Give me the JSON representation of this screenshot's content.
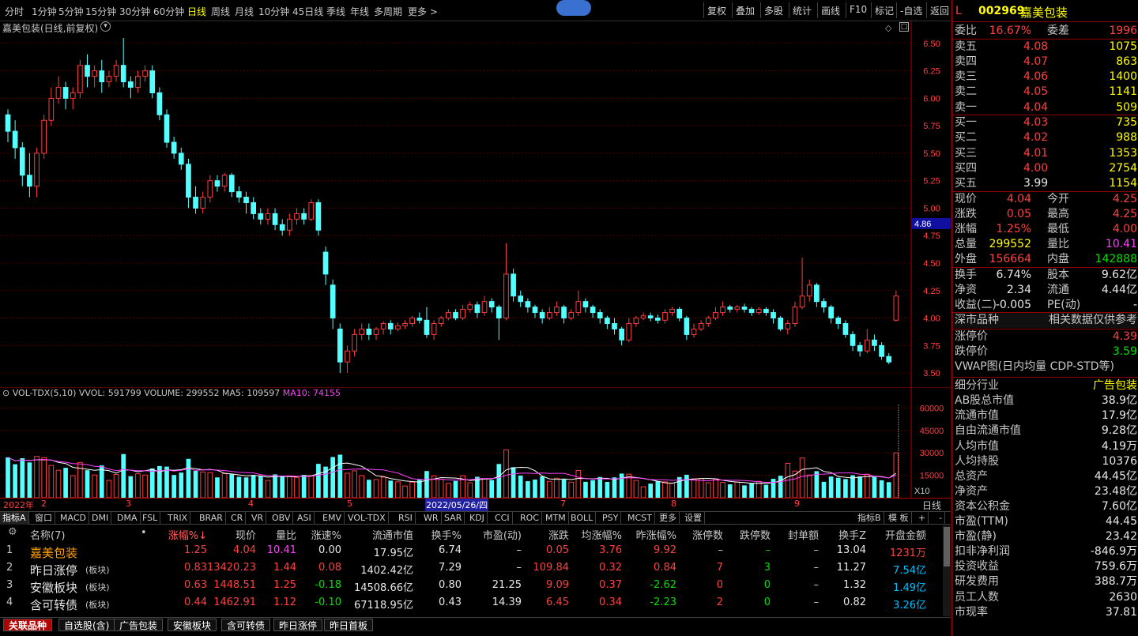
{
  "toolbar": {
    "periods": [
      "分时",
      "1分钟",
      "5分钟",
      "15分钟",
      "30分钟",
      "60分钟",
      "日线",
      "周线",
      "月线",
      "10分钟",
      "45日线",
      "季线",
      "年线",
      "多周期",
      "更多 >"
    ],
    "active_period": "日线",
    "buttons": [
      "复权",
      "叠加",
      "多股",
      "统计",
      "画线",
      "F10",
      "标记",
      "-自选",
      "返回"
    ]
  },
  "chart": {
    "title": "嘉美包装(日线,前复权)",
    "price_ticks": [
      "6.50",
      "6.25",
      "6.00",
      "5.75",
      "5.50",
      "5.25",
      "5.00",
      "4.75",
      "4.50",
      "4.25",
      "4.00",
      "3.75",
      "3.50"
    ],
    "current_price_tag": "4.86",
    "vol_header_name": "VOL-TDX(5,10)",
    "vol_header_vvol": "VVOL: 591799",
    "vol_header_volume": "VOLUME: 299552",
    "vol_header_ma5": "MA5: 109597",
    "vol_header_ma10": "MA10: 74155",
    "vol_ticks": [
      "60000",
      "45000",
      "30000",
      "15000"
    ],
    "vol_unit": "X10",
    "date_labels": [
      "2022年",
      "2",
      "3",
      "4",
      "5",
      "2022/05/26/四",
      "7",
      "8",
      "9"
    ],
    "date_right": "日线"
  },
  "chart_data": {
    "type": "candlestick",
    "title": "嘉美包装(日线,前复权)",
    "ylim": [
      3.45,
      6.6
    ],
    "candles": [
      [
        5.85,
        5.7,
        5.9,
        5.6
      ],
      [
        5.7,
        5.55,
        5.8,
        5.45
      ],
      [
        5.55,
        5.3,
        5.6,
        5.2
      ],
      [
        5.3,
        5.2,
        5.5,
        5.1
      ],
      [
        5.2,
        5.5,
        5.55,
        5.1
      ],
      [
        5.5,
        5.8,
        5.85,
        5.45
      ],
      [
        5.8,
        6.0,
        6.1,
        5.75
      ],
      [
        6.0,
        6.1,
        6.2,
        5.95
      ],
      [
        6.1,
        6.0,
        6.15,
        5.9
      ],
      [
        6.0,
        6.05,
        6.1,
        5.9
      ],
      [
        6.05,
        6.3,
        6.35,
        6.0
      ],
      [
        6.3,
        6.2,
        6.4,
        6.1
      ],
      [
        6.2,
        6.25,
        6.3,
        6.1
      ],
      [
        6.25,
        6.15,
        6.35,
        6.05
      ],
      [
        6.15,
        6.2,
        6.25,
        6.1
      ],
      [
        6.2,
        6.3,
        6.35,
        6.15
      ],
      [
        6.3,
        6.15,
        6.55,
        6.1
      ],
      [
        6.15,
        6.1,
        6.2,
        6.0
      ],
      [
        6.1,
        6.2,
        6.25,
        6.05
      ],
      [
        6.2,
        6.25,
        6.3,
        6.15
      ],
      [
        6.25,
        6.05,
        6.3,
        6.0
      ],
      [
        6.05,
        5.85,
        6.1,
        5.8
      ],
      [
        5.85,
        5.6,
        5.9,
        5.55
      ],
      [
        5.6,
        5.5,
        5.65,
        5.45
      ],
      [
        5.5,
        5.4,
        5.55,
        5.35
      ],
      [
        5.4,
        5.1,
        5.45,
        5.0
      ],
      [
        5.1,
        5.0,
        5.2,
        4.95
      ],
      [
        5.0,
        5.1,
        5.15,
        4.95
      ],
      [
        5.1,
        5.25,
        5.3,
        5.05
      ],
      [
        5.25,
        5.2,
        5.3,
        5.15
      ],
      [
        5.2,
        5.3,
        5.32,
        5.15
      ],
      [
        5.3,
        5.15,
        5.32,
        5.1
      ],
      [
        5.15,
        5.1,
        5.2,
        5.05
      ],
      [
        5.1,
        5.05,
        5.15,
        4.95
      ],
      [
        5.05,
        4.95,
        5.1,
        4.9
      ],
      [
        4.95,
        4.9,
        5.0,
        4.85
      ],
      [
        4.9,
        4.95,
        5.0,
        4.85
      ],
      [
        4.95,
        4.85,
        5.0,
        4.8
      ],
      [
        4.85,
        4.8,
        4.9,
        4.75
      ],
      [
        4.8,
        4.9,
        4.95,
        4.75
      ],
      [
        4.9,
        4.95,
        5.0,
        4.85
      ],
      [
        4.95,
        4.9,
        5.0,
        4.85
      ],
      [
        4.9,
        5.05,
        5.08,
        4.88
      ],
      [
        5.05,
        4.8,
        5.08,
        4.75
      ],
      [
        4.6,
        4.4,
        4.65,
        4.3
      ],
      [
        4.3,
        4.0,
        4.35,
        3.9
      ],
      [
        3.9,
        3.6,
        3.95,
        3.5
      ],
      [
        3.6,
        3.7,
        3.75,
        3.5
      ],
      [
        3.7,
        3.85,
        3.9,
        3.65
      ],
      [
        3.85,
        3.9,
        3.95,
        3.8
      ],
      [
        3.9,
        3.85,
        3.95,
        3.8
      ],
      [
        3.85,
        3.9,
        3.92,
        3.8
      ],
      [
        3.9,
        3.95,
        3.97,
        3.85
      ],
      [
        3.95,
        3.9,
        3.98,
        3.85
      ],
      [
        3.9,
        3.93,
        3.96,
        3.88
      ],
      [
        3.93,
        3.95,
        3.98,
        3.9
      ],
      [
        3.95,
        4.0,
        4.02,
        3.92
      ],
      [
        4.0,
        3.98,
        4.05,
        3.95
      ],
      [
        3.98,
        3.85,
        4.1,
        3.82
      ],
      [
        3.85,
        3.95,
        3.98,
        3.8
      ],
      [
        3.95,
        4.0,
        4.02,
        3.92
      ],
      [
        4.0,
        4.05,
        4.08,
        3.98
      ],
      [
        4.05,
        4.0,
        4.08,
        3.98
      ],
      [
        4.0,
        4.08,
        4.12,
        3.98
      ],
      [
        4.08,
        4.12,
        4.15,
        4.05
      ],
      [
        4.12,
        4.05,
        4.15,
        4.0
      ],
      [
        4.05,
        4.15,
        4.2,
        4.02
      ],
      [
        4.15,
        4.1,
        4.18,
        4.05
      ],
      [
        4.1,
        4.0,
        4.12,
        3.8
      ],
      [
        4.0,
        4.4,
        4.68,
        3.98
      ],
      [
        4.4,
        4.2,
        4.45,
        4.15
      ],
      [
        4.2,
        4.15,
        4.25,
        4.1
      ],
      [
        4.15,
        4.1,
        4.18,
        4.05
      ],
      [
        4.1,
        4.05,
        4.12,
        4.0
      ],
      [
        4.05,
        4.0,
        4.08,
        3.95
      ],
      [
        4.0,
        4.05,
        4.1,
        3.98
      ],
      [
        4.05,
        4.1,
        4.15,
        4.02
      ],
      [
        4.1,
        4.0,
        4.12,
        3.95
      ],
      [
        4.0,
        4.05,
        4.08,
        3.98
      ],
      [
        4.05,
        4.15,
        4.25,
        4.02
      ],
      [
        4.15,
        4.1,
        4.18,
        4.05
      ],
      [
        4.1,
        4.05,
        4.12,
        4.0
      ],
      [
        4.05,
        4.0,
        4.08,
        3.95
      ],
      [
        4.0,
        3.95,
        4.02,
        3.9
      ],
      [
        3.95,
        3.9,
        4.0,
        3.85
      ],
      [
        3.9,
        3.8,
        3.92,
        3.75
      ],
      [
        3.8,
        3.95,
        4.0,
        3.78
      ],
      [
        3.95,
        4.0,
        4.02,
        3.92
      ],
      [
        4.0,
        4.02,
        4.05,
        3.98
      ],
      [
        4.02,
        4.0,
        4.05,
        3.97
      ],
      [
        4.0,
        3.98,
        4.03,
        3.95
      ],
      [
        3.98,
        4.05,
        4.08,
        3.95
      ],
      [
        4.05,
        4.08,
        4.1,
        4.02
      ],
      [
        4.08,
        4.0,
        4.1,
        3.97
      ],
      [
        4.0,
        3.85,
        4.02,
        3.8
      ],
      [
        3.85,
        3.9,
        3.95,
        3.82
      ],
      [
        3.9,
        3.95,
        3.98,
        3.88
      ],
      [
        3.95,
        4.0,
        4.02,
        3.92
      ],
      [
        4.0,
        4.05,
        4.1,
        3.98
      ],
      [
        4.05,
        4.1,
        4.15,
        4.02
      ],
      [
        4.1,
        4.08,
        4.12,
        4.05
      ],
      [
        4.08,
        4.1,
        4.12,
        4.05
      ],
      [
        4.1,
        4.08,
        4.13,
        4.05
      ],
      [
        4.08,
        4.05,
        4.1,
        4.02
      ],
      [
        4.05,
        4.08,
        4.1,
        4.03
      ],
      [
        4.08,
        4.05,
        4.1,
        4.02
      ],
      [
        4.05,
        4.0,
        4.08,
        3.95
      ],
      [
        4.0,
        3.9,
        4.02,
        3.88
      ],
      [
        3.9,
        3.95,
        3.98,
        3.85
      ],
      [
        3.95,
        4.1,
        4.15,
        3.92
      ],
      [
        4.1,
        4.2,
        4.55,
        4.08
      ],
      [
        4.2,
        4.3,
        4.35,
        4.15
      ],
      [
        4.3,
        4.15,
        4.32,
        4.1
      ],
      [
        4.15,
        4.1,
        4.18,
        4.05
      ],
      [
        4.1,
        4.0,
        4.12,
        3.95
      ],
      [
        4.0,
        3.95,
        4.02,
        3.9
      ],
      [
        3.95,
        3.85,
        3.98,
        3.82
      ],
      [
        3.85,
        3.75,
        3.88,
        3.7
      ],
      [
        3.75,
        3.7,
        3.78,
        3.65
      ],
      [
        3.7,
        3.8,
        3.9,
        3.68
      ],
      [
        3.8,
        3.75,
        3.85,
        3.7
      ],
      [
        3.75,
        3.65,
        3.78,
        3.62
      ],
      [
        3.65,
        3.6,
        3.68,
        3.58
      ],
      [
        3.98,
        4.2,
        4.25,
        3.97
      ]
    ],
    "volume_ma5_label": "MA5",
    "volume_ma10_label": "MA10"
  },
  "quote": {
    "code": "002969",
    "name": "嘉美包装",
    "flag": "L",
    "weibi_label": "委比",
    "weibi": "16.67%",
    "weicha_label": "委差",
    "weicha": "1996",
    "asks": [
      {
        "label": "卖五",
        "price": "4.08",
        "vol": "1075"
      },
      {
        "label": "卖四",
        "price": "4.07",
        "vol": "863"
      },
      {
        "label": "卖三",
        "price": "4.06",
        "vol": "1400"
      },
      {
        "label": "卖二",
        "price": "4.05",
        "vol": "1141"
      },
      {
        "label": "卖一",
        "price": "4.04",
        "vol": "509"
      }
    ],
    "bids": [
      {
        "label": "买一",
        "price": "4.03",
        "vol": "735"
      },
      {
        "label": "买二",
        "price": "4.02",
        "vol": "988"
      },
      {
        "label": "买三",
        "price": "4.01",
        "vol": "1353"
      },
      {
        "label": "买四",
        "price": "4.00",
        "vol": "2754"
      },
      {
        "label": "买五",
        "price": "3.99",
        "vol": "1154"
      }
    ],
    "stats": [
      {
        "l1": "现价",
        "v1": "4.04",
        "c1": "red",
        "l2": "今开",
        "v2": "4.25",
        "c2": "red"
      },
      {
        "l1": "涨跌",
        "v1": "0.05",
        "c1": "red",
        "l2": "最高",
        "v2": "4.25",
        "c2": "red"
      },
      {
        "l1": "涨幅",
        "v1": "1.25%",
        "c1": "red",
        "l2": "最低",
        "v2": "4.00",
        "c2": "red"
      },
      {
        "l1": "总量",
        "v1": "299552",
        "c1": "yel",
        "l2": "量比",
        "v2": "10.41",
        "c2": "mag"
      },
      {
        "l1": "外盘",
        "v1": "156664",
        "c1": "red",
        "l2": "内盘",
        "v2": "142888",
        "c2": "green"
      }
    ],
    "stats2": [
      {
        "l1": "换手",
        "v1": "6.74%",
        "c1": "wht",
        "l2": "股本",
        "v2": "9.62亿",
        "c2": "wht"
      },
      {
        "l1": "净资",
        "v1": "2.34",
        "c1": "wht",
        "l2": "流通",
        "v2": "4.44亿",
        "c2": "wht"
      },
      {
        "l1": "收益(二)",
        "v1": "-0.005",
        "c1": "wht",
        "l2": "PE(动)",
        "v2": "-",
        "c2": "wht"
      }
    ],
    "market_label": "深市品种",
    "market_note": "相关数据仅供参考",
    "limit_up_label": "涨停价",
    "limit_up": "4.39",
    "limit_down_label": "跌停价",
    "limit_down": "3.59",
    "vwap_label": "VWAP图(日内均量 CDP-STD等)",
    "fund": [
      {
        "l": "细分行业",
        "v": "广告包装"
      },
      {
        "l": "AB股总市值",
        "v": "38.9亿"
      },
      {
        "l": "流通市值",
        "v": "17.9亿"
      },
      {
        "l": "自由流通市值",
        "v": "9.28亿"
      },
      {
        "l": "人均市值",
        "v": "4.19万"
      },
      {
        "l": "人均持股",
        "v": "10376"
      },
      {
        "l": "总资产",
        "v": "44.45亿"
      },
      {
        "l": "净资产",
        "v": "23.48亿"
      },
      {
        "l": "资本公积金",
        "v": "7.60亿"
      },
      {
        "l": "市盈(TTM)",
        "v": "44.45"
      },
      {
        "l": "市盈(静)",
        "v": "23.42"
      },
      {
        "l": "扣非净利润",
        "v": "-846.9万"
      },
      {
        "l": "投资收益",
        "v": "759.6万"
      },
      {
        "l": "研发费用",
        "v": "388.7万"
      },
      {
        "l": "员工人数",
        "v": "2630"
      },
      {
        "l": "市现率",
        "v": "37.81"
      }
    ]
  },
  "indicator_tabs": [
    "指标A",
    "窗口",
    "MACD",
    "DMI",
    "DMA",
    "FSL",
    "TRIX",
    "BRAR",
    "CR",
    "VR",
    "OBV",
    "ASI",
    "EMV",
    "VOL-TDX",
    "RSI",
    "WR",
    "SAR",
    "KDJ",
    "CCI",
    "ROC",
    "MTM",
    "BOLL",
    "PSY",
    "MCST",
    "更多",
    "设置"
  ],
  "indicator_right": [
    "指标B",
    "模 板",
    "+",
    "-"
  ],
  "table": {
    "headers": [
      "",
      "名称(7)",
      "•",
      "涨幅%↓",
      "现价",
      "量比",
      "涨速%",
      "流通市值",
      "换手%",
      "市盈(动)",
      "涨跌",
      "均涨幅%",
      "昨涨幅%",
      "涨停数",
      "跌停数",
      "封单额",
      "换手Z",
      "开盘金额"
    ],
    "rows": [
      {
        "idx": "1",
        "name": "嘉美包装",
        "tag": "",
        "chg": "1.25",
        "price": "4.04",
        "lb": "10.41",
        "speed": "0.00",
        "mcap": "17.95亿",
        "hs": "6.74",
        "pe": "–",
        "zd": "0.05",
        "avg": "3.76",
        "yday": "9.92",
        "up": "–",
        "down": "–",
        "fd": "–",
        "hsz": "13.04",
        "open": "1231万"
      },
      {
        "idx": "2",
        "name": "昨日涨停",
        "tag": "(板块)",
        "chg": "0.83",
        "price": "13420.23",
        "lb": "1.44",
        "speed": "0.08",
        "mcap": "1402.42亿",
        "hs": "7.29",
        "pe": "–",
        "zd": "109.84",
        "avg": "0.32",
        "yday": "0.84",
        "up": "7",
        "down": "3",
        "fd": "–",
        "hsz": "11.27",
        "open": "7.54亿"
      },
      {
        "idx": "3",
        "name": "安徽板块",
        "tag": "(板块)",
        "chg": "0.63",
        "price": "1448.51",
        "lb": "1.25",
        "speed": "-0.18",
        "mcap": "14508.66亿",
        "hs": "0.80",
        "pe": "21.25",
        "zd": "9.09",
        "avg": "0.37",
        "yday": "-2.62",
        "up": "0",
        "down": "0",
        "fd": "–",
        "hsz": "1.32",
        "open": "1.49亿"
      },
      {
        "idx": "4",
        "name": "含可转债",
        "tag": "(板块)",
        "chg": "0.44",
        "price": "1462.91",
        "lb": "1.12",
        "speed": "-0.10",
        "mcap": "67118.95亿",
        "hs": "0.43",
        "pe": "14.39",
        "zd": "6.45",
        "avg": "0.34",
        "yday": "-2.23",
        "up": "2",
        "down": "0",
        "fd": "–",
        "hsz": "0.82",
        "open": "3.26亿"
      }
    ]
  },
  "bottom_tabs": [
    "关联品种",
    "自选股(含)",
    "广告包装",
    "安徽板块",
    "含可转债",
    "昨日涨停",
    "昨日首板"
  ],
  "colors": {
    "up": "#ff3c3c",
    "down": "#54ffff",
    "grid": "#b00000",
    "ma5": "#ffffff",
    "ma10": "#ff40ff"
  }
}
